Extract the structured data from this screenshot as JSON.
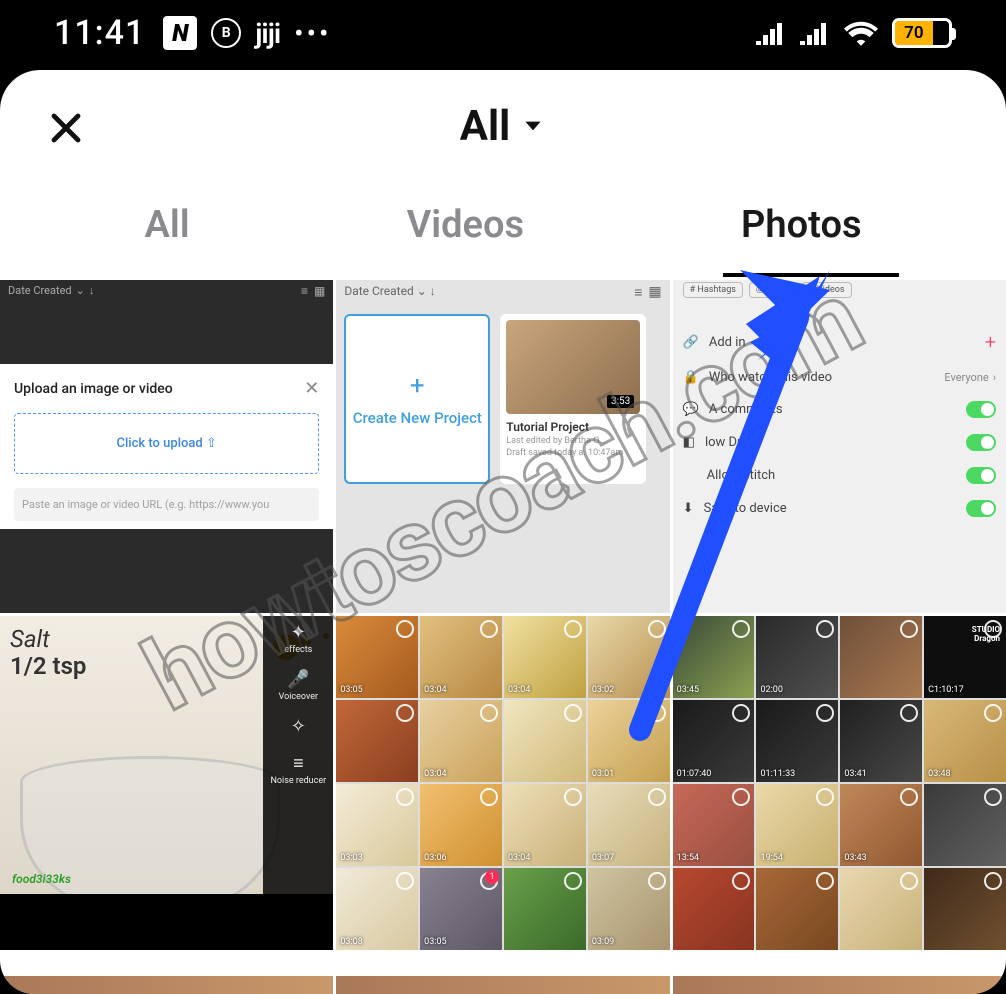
{
  "statusbar": {
    "time": "11:41",
    "n_icon": "N",
    "b_icon": "B",
    "jiji": "jiji",
    "dots": "•••",
    "battery": "70"
  },
  "header": {
    "title": "All"
  },
  "tabs": {
    "all": "All",
    "videos": "Videos",
    "photos": "Photos"
  },
  "cell1": {
    "sort": "Date Created",
    "title": "Upload an image or video",
    "cta": "Click to upload  ⇧",
    "placeholder": "Paste an image or video URL (e.g. https://www.you"
  },
  "cell2": {
    "sort": "Date Created",
    "create": "Create New Project",
    "duration": "3:53",
    "projectName": "Tutorial Project",
    "editedBy": "Last edited by Bertha O...",
    "savedAt": "Draft saved today a. 10:47am"
  },
  "cell3": {
    "chips": {
      "hashtags": "# Hashtags",
      "sounds": "◎ ...nds",
      "videos": "▷ Videos"
    },
    "rows": {
      "addLink": "Add  in",
      "privacy": "Who         watch this video",
      "privacyValue": "Everyone",
      "comments": "A        comments",
      "duet": "low Duet",
      "stitch": "Allow Stitch",
      "save": "Save to device"
    }
  },
  "cell4": {
    "line1": "Salt",
    "line2": "1/2 tsp",
    "brand": "food3i33ks",
    "side": {
      "effects": "effects",
      "voiceover": "Voiceover",
      "enhance": "",
      "noise": "Noise reducer"
    }
  },
  "grid5": {
    "ts": [
      "03:05",
      "03:04",
      "03:04",
      "03:02",
      "",
      "03:04",
      "",
      "03:01",
      "03:03",
      "03:06",
      "03:04",
      "03:07",
      "03:08",
      "03:05",
      "",
      "03:09"
    ]
  },
  "grid5_badge": "1",
  "grid6": {
    "ts": [
      "03:45",
      "02:00",
      "",
      "C1:10:17",
      "01:07:40",
      "01:11:33",
      "03:41",
      "03:48",
      "13:54",
      "19:54",
      "03:43",
      "",
      "",
      "",
      "",
      ""
    ],
    "studio": "STUDIO Dragon"
  },
  "watermark": "howtoscoach.com"
}
